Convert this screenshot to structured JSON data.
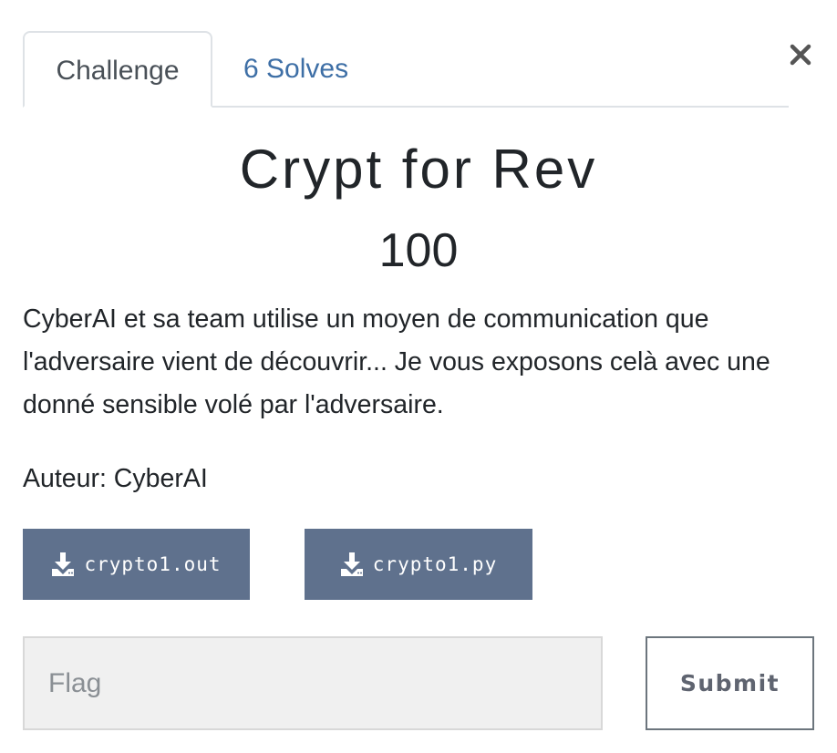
{
  "tabs": [
    {
      "label": "Challenge",
      "active": true
    },
    {
      "label": "6 Solves",
      "active": false
    }
  ],
  "close": {
    "icon": "close-icon"
  },
  "challenge": {
    "name": "Crypt for Rev",
    "value": "100",
    "description": "CyberAI et sa team utilise un moyen de communication que l'adversaire vient de découvrir... Je vous exposons celà avec une donné sensible volé par l'adversaire.",
    "author": "Auteur: CyberAI"
  },
  "files": [
    {
      "label": "crypto1.out",
      "icon": "download-icon"
    },
    {
      "label": "crypto1.py",
      "icon": "download-icon"
    }
  ],
  "flag_form": {
    "value": "",
    "placeholder": "Flag",
    "submit_label": "Submit"
  },
  "colors": {
    "tab_link": "#3e6fa6",
    "file_button_bg": "#5f718d",
    "text": "#212529",
    "input_bg": "#f0f0f0"
  }
}
